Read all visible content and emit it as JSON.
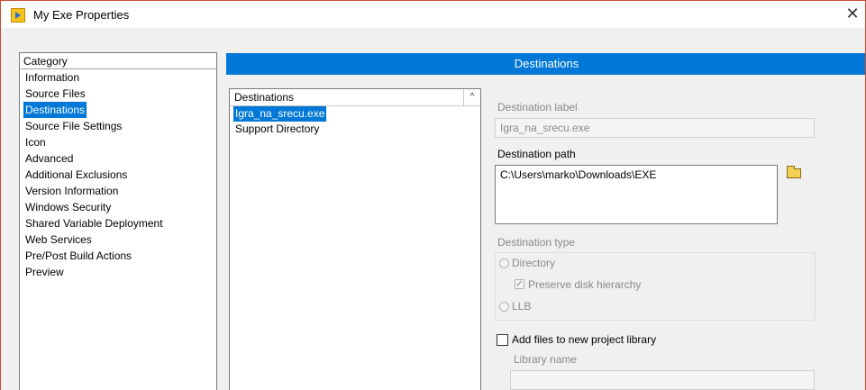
{
  "window": {
    "title": "My Exe Properties",
    "close_glyph": "✕"
  },
  "category": {
    "header": "Category",
    "items": [
      {
        "label": "Information"
      },
      {
        "label": "Source Files"
      },
      {
        "label": "Destinations",
        "selected": true
      },
      {
        "label": "Source File Settings"
      },
      {
        "label": "Icon"
      },
      {
        "label": "Advanced"
      },
      {
        "label": "Additional Exclusions"
      },
      {
        "label": "Version Information"
      },
      {
        "label": "Windows Security"
      },
      {
        "label": "Shared Variable Deployment"
      },
      {
        "label": "Web Services"
      },
      {
        "label": "Pre/Post Build Actions"
      },
      {
        "label": "Preview"
      }
    ]
  },
  "section": {
    "title": "Destinations"
  },
  "destinations": {
    "header": "Destinations",
    "scroll_glyph": "^",
    "items": [
      {
        "label": "Igra_na_srecu.exe",
        "selected": true
      },
      {
        "label": "Support Directory"
      }
    ]
  },
  "form": {
    "destination_label_caption": "Destination label",
    "destination_label_value": "Igra_na_srecu.exe",
    "destination_path_caption": "Destination path",
    "destination_path_value": "C:\\Users\\marko\\Downloads\\EXE",
    "destination_type_caption": "Destination type",
    "type_directory": "Directory",
    "preserve_hierarchy": "Preserve disk hierarchy",
    "preserve_check_glyph": "✓",
    "type_llb": "LLB",
    "add_files_label": "Add files to new project library",
    "library_name_caption": "Library name",
    "library_name_value": ""
  },
  "colors": {
    "accent": "#0078d7",
    "window_border": "#c94a2c"
  },
  "icons": {
    "app": "labview-app-icon",
    "folder": "open-folder-icon",
    "close": "close-icon"
  }
}
